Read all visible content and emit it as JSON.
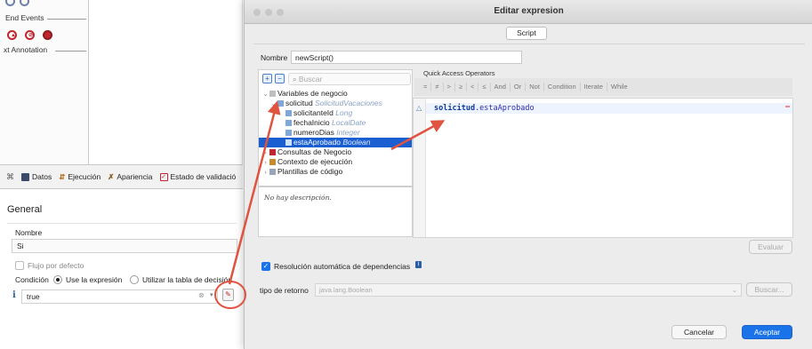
{
  "palette": {
    "end_events_label": "End Events",
    "text_annotation_label": "xt Annotation"
  },
  "tabs": [
    {
      "label": "Datos",
      "icon": "data-icon"
    },
    {
      "label": "Ejecución",
      "icon": "execution-icon"
    },
    {
      "label": "Apariencia",
      "icon": "appearance-icon"
    },
    {
      "label": "Estado de validació",
      "icon": "validation-checkbox-icon"
    }
  ],
  "props": {
    "title": "General",
    "nombre_label": "Nombre",
    "nombre_value": "Si",
    "flujo_label": "Flujo por defecto",
    "condicion_label": "Condición",
    "use_expr_label": "Use la expresión",
    "use_table_label": "Utilizar la tabla de decisión",
    "expression_value": "true"
  },
  "dialog": {
    "title": "Editar expresion",
    "tab_label": "Script",
    "nombre_label": "Nombre",
    "nombre_value": "newScript()",
    "search_placeholder": "Buscar",
    "tree": [
      {
        "label": "Variables de negocio",
        "type": "",
        "depth": 0,
        "toggle": "v",
        "icon": "folder-icon",
        "selected": false
      },
      {
        "label": "solicitud",
        "type": "SolicitudVacaciones",
        "depth": 1,
        "toggle": "v",
        "icon": "variable-icon",
        "selected": false
      },
      {
        "label": "solicitanteId",
        "type": "Long",
        "depth": 2,
        "toggle": "",
        "icon": "field-icon",
        "selected": false
      },
      {
        "label": "fechaInicio",
        "type": "LocalDate",
        "depth": 2,
        "toggle": "",
        "icon": "field-icon",
        "selected": false
      },
      {
        "label": "numeroDias",
        "type": "Integer",
        "depth": 2,
        "toggle": "",
        "icon": "field-icon",
        "selected": false
      },
      {
        "label": "estaAprobado",
        "type": "Boolean",
        "depth": 2,
        "toggle": "",
        "icon": "field-icon",
        "selected": true
      },
      {
        "label": "Consultas de Negocio",
        "type": "",
        "depth": 0,
        "toggle": ">",
        "icon": "query-icon",
        "selected": false
      },
      {
        "label": "Contexto de ejecución",
        "type": "",
        "depth": 0,
        "toggle": ">",
        "icon": "context-icon",
        "selected": false
      },
      {
        "label": "Plantillas de código",
        "type": "",
        "depth": 0,
        "toggle": ">",
        "icon": "template-icon",
        "selected": false
      }
    ],
    "description": "No hay descripción.",
    "quick_access_label": "Quick Access Operators",
    "operators": [
      "=",
      "≠",
      ">",
      "≥",
      "<",
      "≤",
      "And",
      "Or",
      "Not",
      "Condition",
      "Iterate",
      "While"
    ],
    "code_object": "solicitud",
    "code_member": ".estaAprobado",
    "evaluar_label": "Evaluar",
    "auto_resolve_label": "Resolución automática de dependencias",
    "return_type_label": "tipo de retorno",
    "return_type_value": "java.lang.Boolean",
    "buscar_label": "Buscar...",
    "cancel_label": "Cancelar",
    "accept_label": "Aceptar"
  },
  "colors": {
    "accent": "#1a73e8",
    "selection": "#1a5fd1",
    "annotation_red": "#e0533f"
  }
}
